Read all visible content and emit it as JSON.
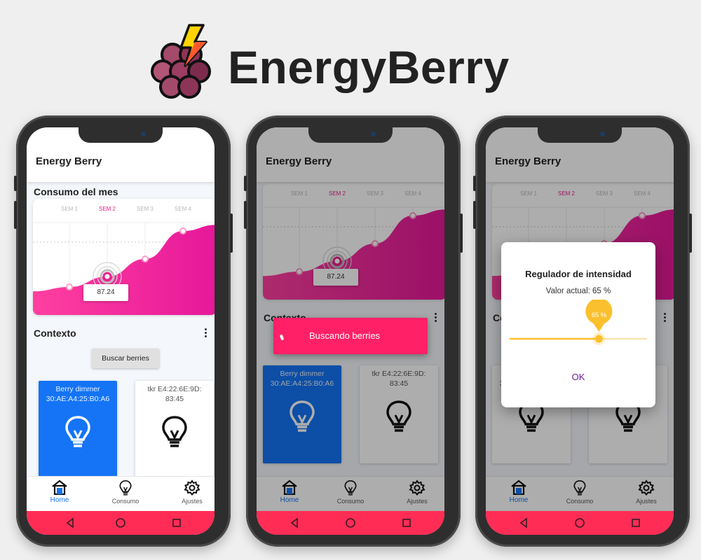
{
  "brand": {
    "title": "EnergyBerry",
    "logo_icon": "grape-bolt-logo",
    "colors": {
      "berry": "#9c3d63",
      "bolt": "#ffd400",
      "bolt_accent": "#ff5a2c"
    }
  },
  "colors": {
    "accent_pink": "#e91e8c",
    "system_bar": "#ff2d55",
    "nav_active": "#1474f5",
    "snackbar": "#ff2068",
    "slider": "#fbc02d",
    "dialog_button": "#6a1b9a"
  },
  "app": {
    "title": "Energy Berry",
    "chart_section_title": "Consumo del mes",
    "context_section_title": "Contexto",
    "search_button_label": "Buscar berries",
    "chart_tooltip_value": "87.24",
    "device_cards": [
      {
        "label": "Berry dimmer 30:AE:A4:25:B0:A6",
        "style": "blue",
        "icon": "lightbulb-icon"
      },
      {
        "label": "tkr E4:22:6E:9D: 83:45",
        "style": "white",
        "icon": "lightbulb-icon"
      }
    ],
    "nav": [
      {
        "label": "Home",
        "icon": "home-icon",
        "active": true
      },
      {
        "label": "Consumo",
        "icon": "lightbulb-icon",
        "active": false
      },
      {
        "label": "Ajustes",
        "icon": "gear-icon",
        "active": false
      }
    ],
    "system_nav": [
      "back-icon",
      "home-circle-icon",
      "recents-icon"
    ]
  },
  "chart_data": {
    "type": "area",
    "categories": [
      "SEM 1",
      "SEM 2",
      "SEM 3",
      "SEM 4"
    ],
    "selected_category": "SEM 2",
    "values": [
      1.6,
      2.2,
      3.2,
      4.8
    ],
    "highlighted_value": 87.24,
    "xlabel": "",
    "ylabel": "",
    "grid": true
  },
  "snackbar": {
    "message": "Buscando berries"
  },
  "dialog": {
    "title": "Regulador de intensidad",
    "current_value_text": "Valor actual: 65 %",
    "value_bubble": "65 %",
    "slider_value": 0.65,
    "ok_label": "OK"
  }
}
